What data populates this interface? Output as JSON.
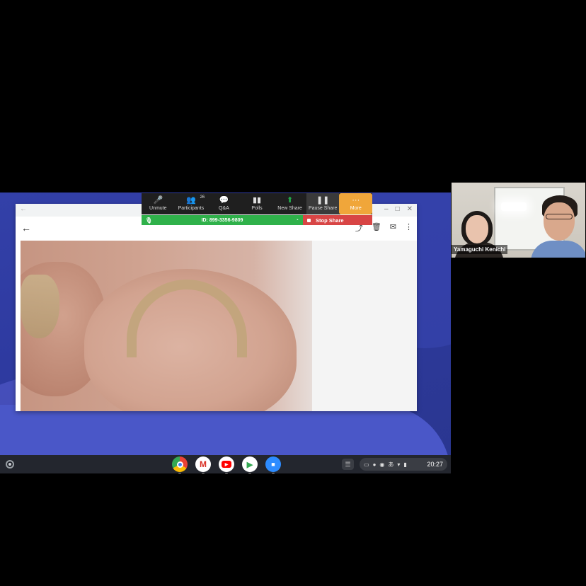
{
  "share_toolbar": {
    "items": [
      {
        "label": "Unmute",
        "icon": "muted-mic-icon"
      },
      {
        "label": "Participants",
        "icon": "participants-icon",
        "badge": "26"
      },
      {
        "label": "Q&A",
        "icon": "qa-icon"
      },
      {
        "label": "Polls",
        "icon": "polls-icon"
      },
      {
        "label": "New Share",
        "icon": "new-share-icon"
      },
      {
        "label": "Pause Share",
        "icon": "pause-icon"
      },
      {
        "label": "More",
        "icon": "more-icon"
      }
    ]
  },
  "meeting_bar": {
    "id_text": "ID: 899-3356-9809",
    "stop_share_label": "Stop Share"
  },
  "video_tile": {
    "participant_name": "Yamaguchi Kenichi"
  },
  "shelf": {
    "apps": [
      "chrome-icon",
      "gmail-icon",
      "youtube-icon",
      "play-store-icon",
      "zoom-icon"
    ],
    "clock": "20:27"
  },
  "colors": {
    "more_button": "#f0a63a",
    "meeting_bar": "#2fb14a",
    "stop_share": "#d84545",
    "wallpaper": "#3340a8"
  }
}
